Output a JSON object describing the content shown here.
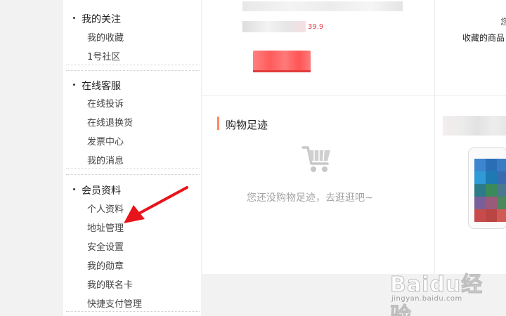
{
  "sidebar": {
    "sections": [
      {
        "title": "我的关注",
        "items": [
          "我的收藏",
          "1号社区"
        ]
      },
      {
        "title": "在线客服",
        "items": [
          "在线投诉",
          "在线退换货",
          "发票中心",
          "我的消息"
        ]
      },
      {
        "title": "会员资料",
        "items": [
          "个人资料",
          "地址管理",
          "安全设置",
          "我的勋章",
          "我的联名卡",
          "快捷支付管理"
        ]
      }
    ]
  },
  "main": {
    "product_price": "39.9",
    "favorite_hint": "收藏的商品",
    "favorite_hint_top": "您",
    "history_title": "购物足迹",
    "history_empty": "您还没购物足迹，去逛逛吧~"
  },
  "icons": {
    "cart": "shopping-cart-icon",
    "arrow": "annotation-arrow-icon"
  },
  "watermark": {
    "brand": "Baidu经验",
    "url": "jingyan.baidu.com"
  },
  "colors": {
    "accent": "#ff8a5c",
    "button": "#ff5b5b",
    "arrow": "#e8141b",
    "muted_text": "#a4a4a4"
  }
}
